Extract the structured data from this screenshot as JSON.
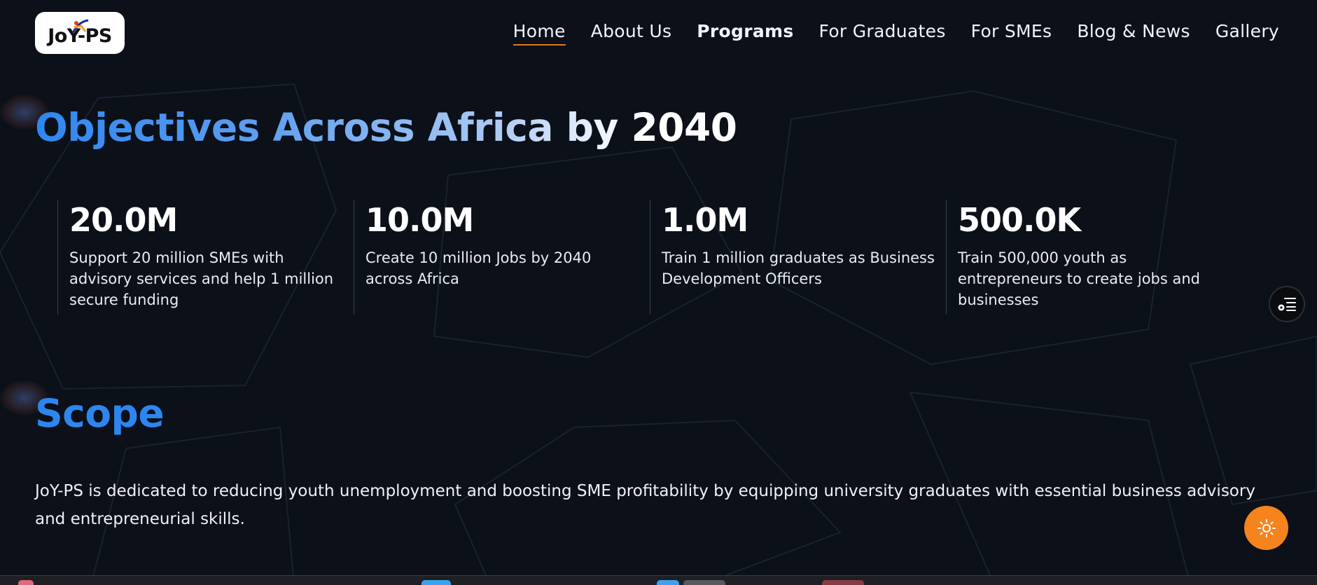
{
  "brand": {
    "logo_text": "JoY-PS"
  },
  "nav": {
    "items": [
      {
        "label": "Home",
        "active": true,
        "bold": false
      },
      {
        "label": "About Us",
        "active": false,
        "bold": false
      },
      {
        "label": "Programs",
        "active": false,
        "bold": true
      },
      {
        "label": "For Graduates",
        "active": false,
        "bold": false
      },
      {
        "label": "For SMEs",
        "active": false,
        "bold": false
      },
      {
        "label": "Blog & News",
        "active": false,
        "bold": false
      },
      {
        "label": "Gallery",
        "active": false,
        "bold": false
      }
    ]
  },
  "objectives": {
    "title": "Objectives Across Africa by 2040",
    "stats": [
      {
        "value": "20.0M",
        "description": "Support 20 million SMEs with advisory services and help 1 million secure funding"
      },
      {
        "value": "10.0M",
        "description": "Create 10 million Jobs by 2040 across Africa"
      },
      {
        "value": "1.0M",
        "description": "Train 1 million graduates as Business Development Officers"
      },
      {
        "value": "500.0K",
        "description": "Train 500,000 youth as entrepreneurs to create jobs and businesses"
      }
    ]
  },
  "scope": {
    "title": "Scope",
    "text": "JoY-PS is dedicated to reducing youth unemployment and boosting SME profitability by equipping university graduates with essential business advisory and entrepreneurial skills."
  },
  "floating_buttons": {
    "side_menu_icon": "list-settings-icon",
    "theme_toggle_icon": "sun-icon"
  },
  "colors": {
    "background": "#0b1019",
    "accent_blue": "#2d86f0",
    "accent_orange": "#f5841f",
    "active_underline": "#e07a1a"
  }
}
